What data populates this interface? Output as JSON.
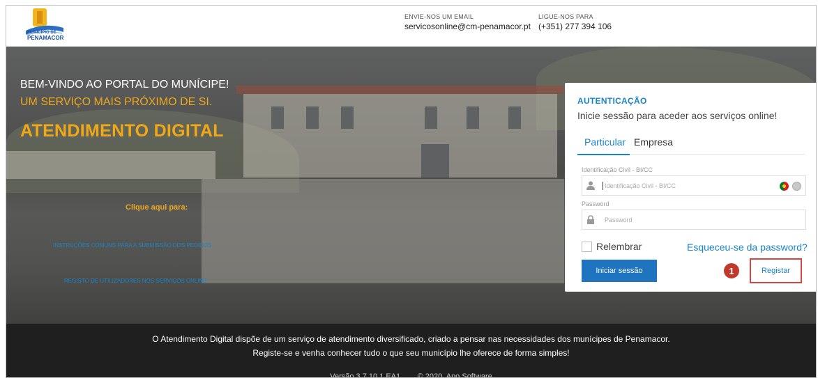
{
  "header": {
    "logo_text_line1": "MUNICÍPIO DE",
    "logo_text_line2": "PENAMACOR",
    "email_label": "ENVIE-NOS UM EMAIL",
    "email_value": "servicosonline@cm-penamacor.pt",
    "phone_label": "LIGUE-NOS PARA",
    "phone_value": "(+351) 277 394 106"
  },
  "hero": {
    "welcome": "BEM-VINDO AO PORTAL DO MUNÍCIPE!",
    "tagline": "UM SERVIÇO MAIS PRÓXIMO DE SI.",
    "title": "ATENDIMENTO DIGITAL",
    "click_here": "Clique aqui para:",
    "link_instructions": "INSTRUÇÕES COMUNS PARA A SUBMISSÃO DOS PEDIDOS",
    "link_register": "REGISTO DE UTILIZADORES NOS SERVIÇOS ONLINE"
  },
  "auth": {
    "title": "AUTENTICAÇÃO",
    "subtitle": "Inicie sessão para aceder aos serviços online!",
    "tabs": [
      {
        "label": "Particular",
        "active": true
      },
      {
        "label": "Empresa",
        "active": false
      }
    ],
    "id_label": "Identificação Civil - BI/CC",
    "id_placeholder": "Identificação Civil - BI/CC",
    "password_label": "Password",
    "password_placeholder": "Password",
    "remember_label": "Relembrar",
    "remember_checked": false,
    "forgot_link": "Esqueceu-se da password?",
    "login_button": "Iniciar sessão",
    "register_button": "Registar",
    "step_badge": "1"
  },
  "footer": {
    "line1": "O Atendimento Digital dispõe de um serviço de atendimento diversificado, criado a pensar nas necessidades dos munícipes de Penamacor.",
    "line2": "Registe-se e venha conhecer tudo o que seu município lhe oferece de forma simples!",
    "line3": "Versão 3.7.10.1.EA1        © 2020  Ano Software"
  },
  "colors": {
    "accent_blue": "#1a84c9",
    "accent_orange": "#f0a818",
    "highlight_red": "#d64541",
    "footer_bg": "#1f1f1f"
  },
  "icons": [
    "logo-icon",
    "user-icon",
    "lock-icon",
    "portugal-flag-icon",
    "globe-icon"
  ]
}
